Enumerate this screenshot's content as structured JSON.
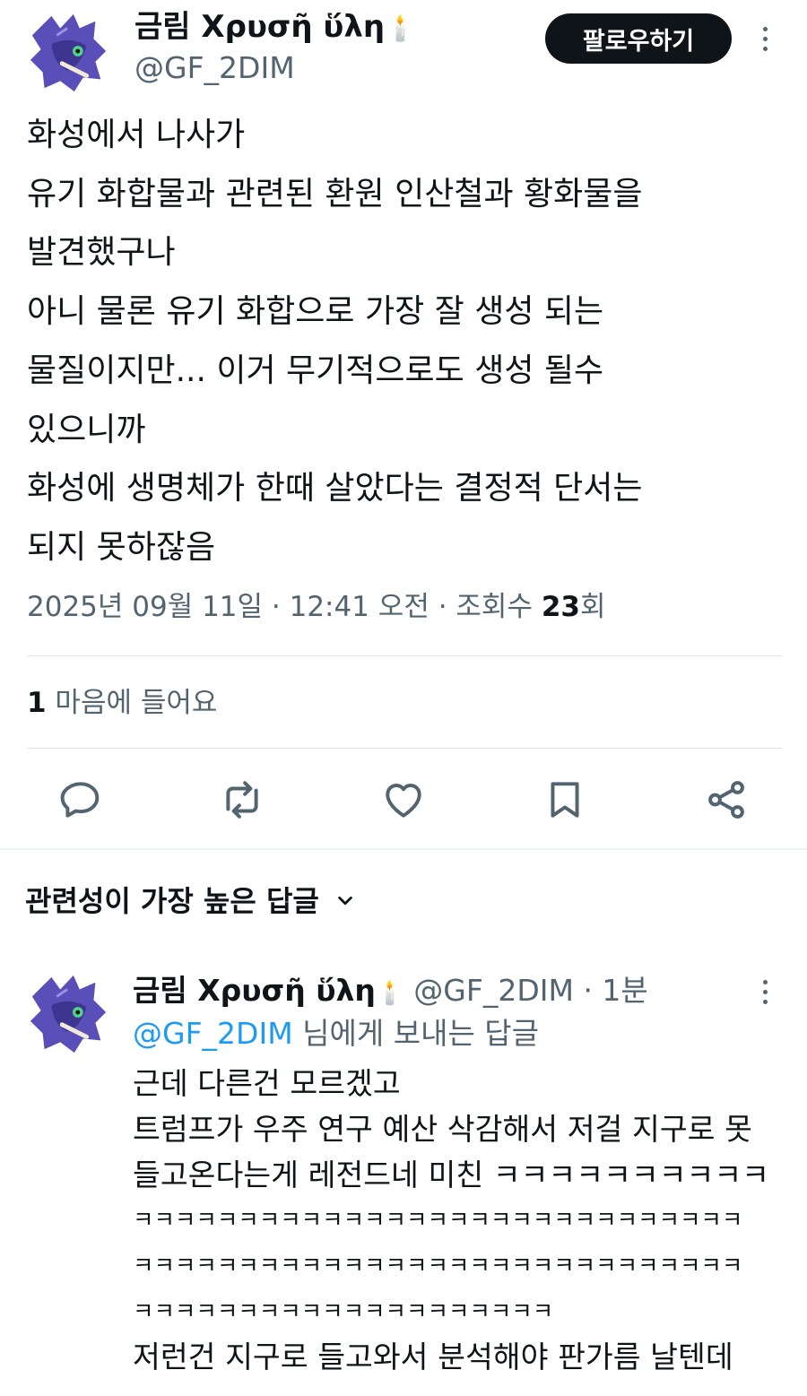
{
  "tweet": {
    "author_name": "금림 Χρυσῆ ὕλη",
    "author_emoji": "🕯️",
    "author_handle": "@GF_2DIM",
    "follow_label": "팔로우하기",
    "text_lines": [
      "화성에서 나사가",
      "유기 화합물과 관련된 환원 인산철과 황화물을",
      "발견했구나",
      "아니 물론 유기 화합으로 가장 잘 생성 되는",
      "물질이지만... 이거 무기적으로도 생성 될수",
      "있으니까",
      "화성에 생명체가 한때 살았다는 결정적 단서는",
      "되지 못하잖음"
    ],
    "timestamp": "2025년 09월 11일 · 12:41 오전 · 조회수 ",
    "views_count": "23",
    "views_suffix": "회",
    "likes_count": "1",
    "likes_label": " 마음에 들어요"
  },
  "actions": {
    "icons": [
      "reply-icon",
      "retweet-icon",
      "like-icon",
      "bookmark-icon",
      "share-icon"
    ]
  },
  "replies_header": {
    "sort_label": "관련성이 가장 높은 답글",
    "chevron_icon": "chevron-down-icon"
  },
  "reply": {
    "author_name": "금림 Χρυσῆ ὕλη",
    "author_emoji": "🕯️",
    "author_handle": "@GF_2DIM",
    "time": " · 1분",
    "replying_to_handle": "@GF_2DIM",
    "replying_to_suffix": " 님에게 보내는 답글",
    "text_lines": [
      "근데 다른건 모르겠고",
      "트럼프가 우주 연구 예산 삭감해서 저걸 지구로 못",
      "들고온다는게 레전드네 미친 ㅋㅋㅋㅋㅋㅋㅋㅋㅋㅋ",
      "ㅋㅋㅋㅋㅋㅋㅋㅋㅋㅋㅋㅋㅋㅋㅋㅋㅋㅋㅋㅋㅋㅋㅋㅋㅋㅋㅋㅋㅋ",
      "ㅋㅋㅋㅋㅋㅋㅋㅋㅋㅋㅋㅋㅋㅋㅋㅋㅋㅋㅋㅋㅋㅋㅋㅋㅋㅋㅋㅋㅋ",
      "ㅋㅋㅋㅋㅋㅋㅋㅋㅋㅋㅋㅋㅋㅋㅋㅋㅋㅋㅋㅋ",
      "저런건 지구로 들고와서 분석해야 판가름 날텐데"
    ]
  },
  "colors": {
    "text": "#0f1419",
    "secondary": "#536471",
    "link": "#1d9bf0",
    "button_bg": "#0f1419",
    "avatar_purple": "#5a4fb8"
  }
}
